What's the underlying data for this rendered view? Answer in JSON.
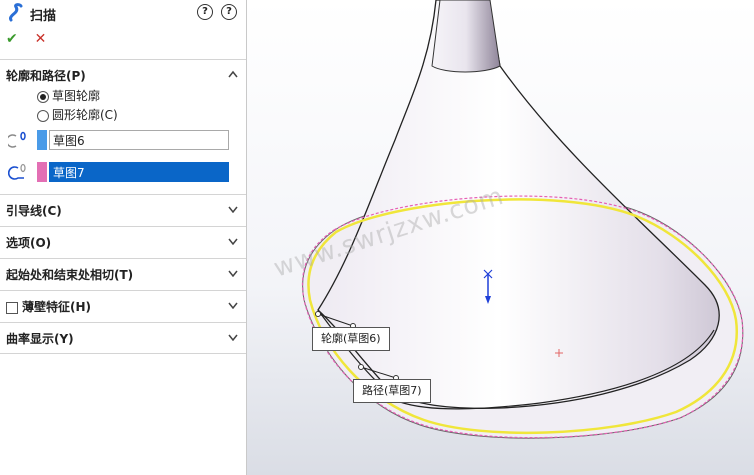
{
  "header": {
    "title": "扫描",
    "help_glyph": "?",
    "help2_glyph": "?"
  },
  "actions": {
    "ok_glyph": "✔",
    "cancel_glyph": "✕"
  },
  "groups": {
    "profile_path": {
      "label": "轮廓和路径(P)",
      "options": [
        {
          "label": "草图轮廓",
          "selected": true
        },
        {
          "label": "圆形轮廓(C)",
          "selected": false
        }
      ],
      "profile_value": "草图6",
      "path_value": "草图7",
      "profile_color": "#4a9be8",
      "path_color": "#e36fb4"
    },
    "guides": {
      "label": "引导线(C)"
    },
    "options": {
      "label": "选项(O)"
    },
    "tangency": {
      "label": "起始处和结束处相切(T)"
    },
    "thin": {
      "label": "薄壁特征(H)"
    },
    "curvature": {
      "label": "曲率显示(Y)"
    }
  },
  "viewport": {
    "callout_profile": "轮廓(草图6)",
    "callout_path": "路径(草图7)",
    "watermark": "www.swrjzxw.com",
    "colors": {
      "preview_path": "#f0e63a",
      "profile_dash": "#e65fb4",
      "axis": "#1f3fd8"
    }
  }
}
